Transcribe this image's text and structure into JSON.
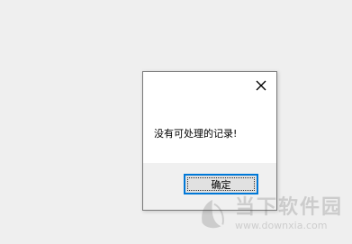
{
  "dialog": {
    "message": "没有可处理的记录!",
    "ok_label": "确定",
    "close_icon": "close-icon"
  },
  "watermark": {
    "name": "当下软件园",
    "url": "www.downxia.com"
  },
  "colors": {
    "background": "#efefef",
    "dialog_bg": "#ffffff",
    "footer_bg": "#f0f0f0",
    "button_focus_border": "#0078d7"
  }
}
